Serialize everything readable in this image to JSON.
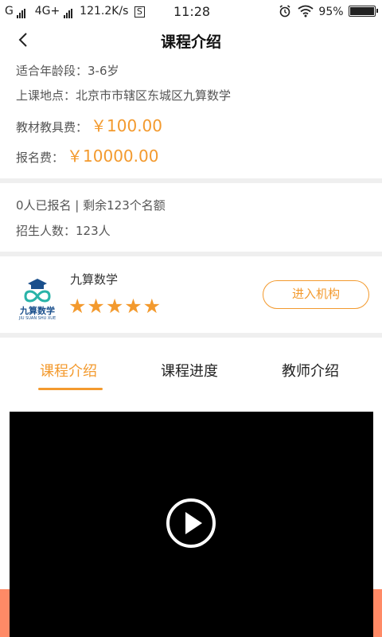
{
  "status_bar": {
    "carrier": "G",
    "network": "4G+",
    "speed": "121.2K/s",
    "sim_badge": "S",
    "time": "11:28",
    "battery": "95%",
    "battery_level": 0.95
  },
  "nav": {
    "title": "课程介绍"
  },
  "course_info": {
    "age_range": "适合年龄段：3-6岁",
    "location": "上课地点：北京市市辖区东城区九算数学",
    "material_fee_label": "教材教具费：",
    "material_fee_value": "￥100.00",
    "signup_fee_label": "报名费：",
    "signup_fee_value": "￥10000.00"
  },
  "enrollment": {
    "status": "0人已报名 | 剩余123个名额",
    "quota": "招生人数：123人"
  },
  "organization": {
    "name": "九算数学",
    "logo_text": "九算数学",
    "logo_subtext": "JIU SUAN SHU XUE",
    "rating": 5,
    "stars": "★★★★★",
    "enter_button": "进入机构"
  },
  "tabs": [
    {
      "label": "课程介绍",
      "active": true
    },
    {
      "label": "课程进度",
      "active": false
    },
    {
      "label": "教师介绍",
      "active": false
    }
  ],
  "colors": {
    "accent": "#f39a2e",
    "strip": "#ff8a66"
  },
  "icons": {
    "back": "chevron-left-icon",
    "play": "play-circle-icon",
    "alarm": "alarm-icon",
    "wifi": "wifi-icon",
    "battery": "battery-icon"
  }
}
